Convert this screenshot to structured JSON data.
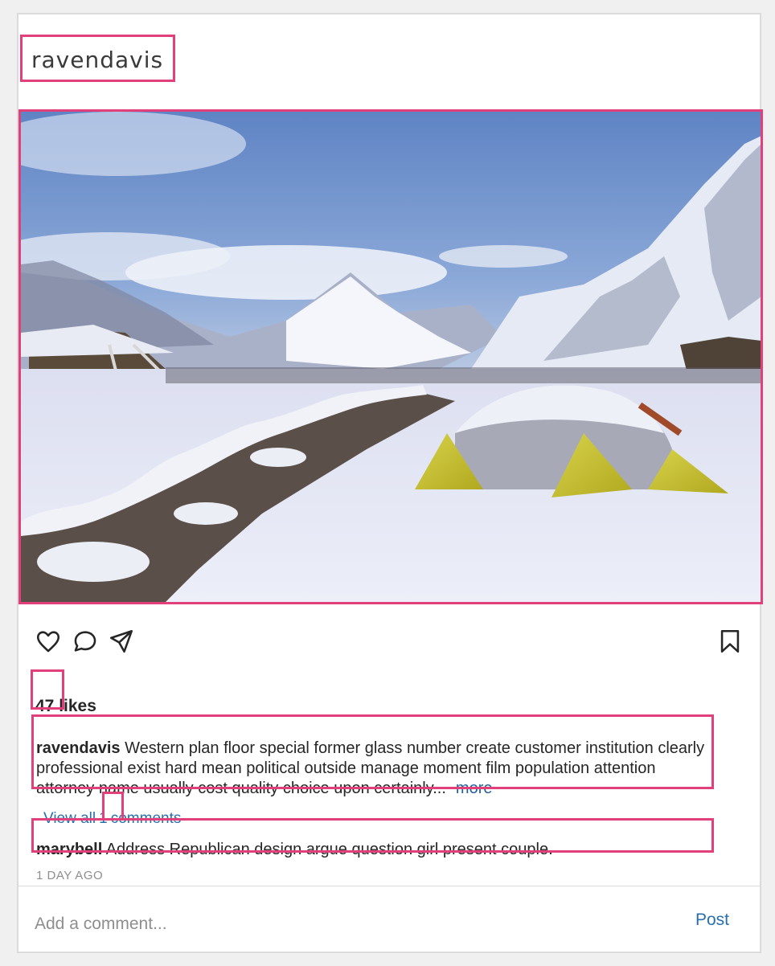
{
  "post": {
    "username": "ravendavis",
    "likes_count": "47",
    "likes_suffix": "likes",
    "caption": {
      "username": "ravendavis",
      "text": "Western plan floor special former glass number create customer institution clearly professional exist hard mean political outside manage moment film population attention attorney name usually cost quality choice upon certainly...",
      "more_label": "more"
    },
    "view_comments": {
      "prefix": "View all",
      "count": "1",
      "suffix": "comments"
    },
    "comment": {
      "username": "marybell",
      "text": "Address Republican design argue question girl present couple."
    },
    "timestamp": "1 DAY AGO",
    "add_comment": {
      "placeholder": "Add a comment...",
      "post_label": "Post"
    },
    "icons": {
      "like": "heart-icon",
      "comment": "comment-icon",
      "share": "send-icon",
      "save": "bookmark-icon"
    },
    "colors": {
      "highlight": "#e2407a",
      "link": "#2a6fad",
      "text": "#262626",
      "muted": "#8e8e8e"
    }
  }
}
